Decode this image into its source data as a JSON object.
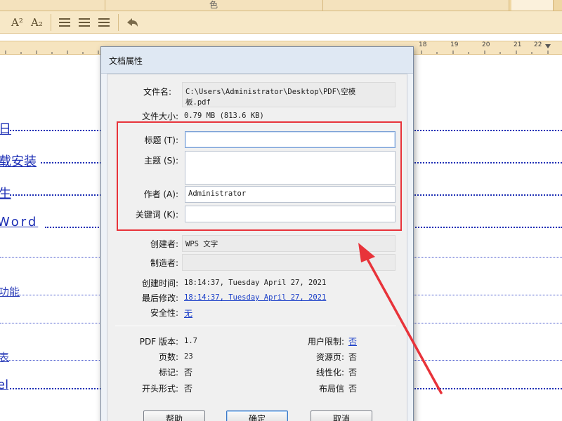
{
  "toolbar": {
    "color_label": "色",
    "superscript_label": "A²",
    "subscript_label": "A₂"
  },
  "ruler": {
    "numbers": [
      "18",
      "19",
      "20",
      "21",
      "22"
    ]
  },
  "document": {
    "lines": [
      "日",
      "载安装",
      "生",
      "Word",
      "功能",
      "表",
      "el"
    ]
  },
  "dialog": {
    "title": "文档属性",
    "file_name_label": "文件名:",
    "file_name_value_line1": "C:\\Users\\Administrator\\Desktop\\PDF\\空模",
    "file_name_value_line2": "板.pdf",
    "file_size_label": "文件大小:",
    "file_size_value": "0.79 MB (813.6 KB)",
    "title_label": "标题 (T):",
    "title_value": "",
    "subject_label": "主题 (S):",
    "subject_value": "",
    "author_label": "作者 (A):",
    "author_value": "Administrator",
    "keywords_label": "关键词 (K):",
    "keywords_value": "",
    "creator_label": "创建者:",
    "creator_value": "WPS 文字",
    "producer_label": "制造者:",
    "producer_value": "",
    "created_label": "创建时间:",
    "created_value": "18:14:37, Tuesday April 27, 2021",
    "modified_label": "最后修改:",
    "modified_value": "18:14:37, Tuesday April 27, 2021",
    "security_label": "安全性:",
    "security_value": "无",
    "pdf_version_label": "PDF 版本:",
    "pdf_version_value": "1.7",
    "pages_label": "页数:",
    "pages_value": "23",
    "tagged_label": "标记:",
    "tagged_value": "否",
    "opening_label": "开头形式:",
    "opening_value": "否",
    "user_restrict_label": "用户限制:",
    "user_restrict_value": "否",
    "resource_label": "资源页:",
    "resource_value": "否",
    "linearized_label": "线性化:",
    "linearized_value": "否",
    "layout_label": "布局信",
    "layout_value": "否",
    "help_button": "帮助",
    "ok_button": "确定",
    "cancel_button": "取消"
  },
  "colors": {
    "annotation": "#e8333a",
    "link": "#1b3fc8",
    "toolbar": "#f7e8c7"
  }
}
